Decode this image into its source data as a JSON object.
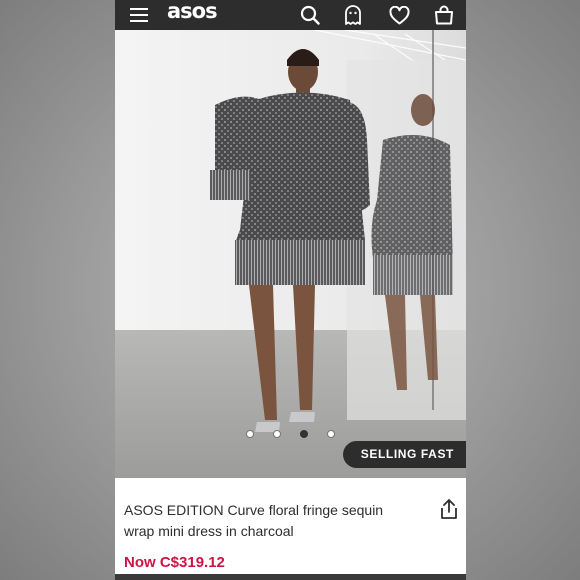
{
  "header": {
    "logo_text": "asos",
    "icons": [
      "menu-icon",
      "search-icon",
      "account-icon",
      "wishlist-icon",
      "bag-icon"
    ]
  },
  "gallery": {
    "image_count": 4,
    "active_index": 2,
    "badge_label": "SELLING FAST"
  },
  "product": {
    "title": "ASOS EDITION Curve floral fringe sequin wrap mini dress in charcoal",
    "price_label": "Now C$319.12",
    "share_icon": "share-icon"
  },
  "colors": {
    "topbar": "#2d2d2d",
    "sale_price": "#d01345",
    "text": "#2d2d2d"
  }
}
